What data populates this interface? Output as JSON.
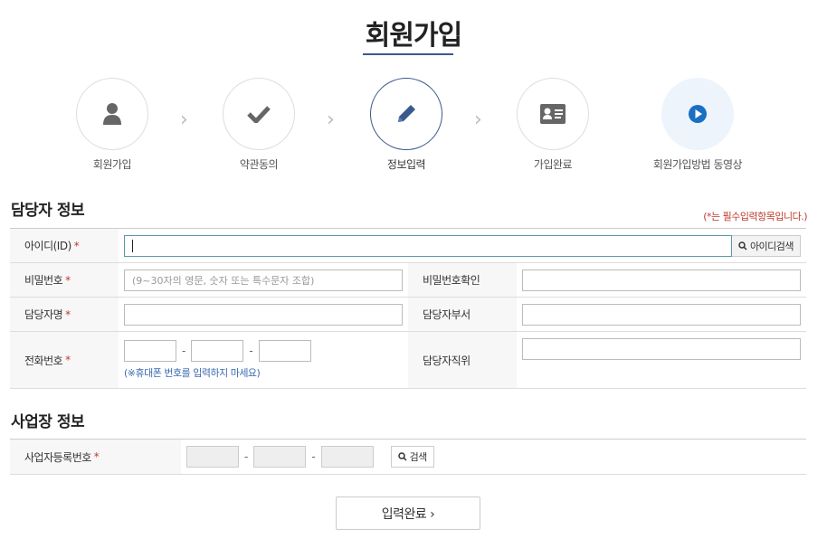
{
  "header": {
    "title": "회원가입"
  },
  "steps": [
    {
      "label": "회원가입",
      "icon": "user-icon"
    },
    {
      "label": "약관동의",
      "icon": "check-icon"
    },
    {
      "label": "정보입력",
      "icon": "pencil-icon"
    },
    {
      "label": "가입완료",
      "icon": "id-card-icon"
    },
    {
      "label": "회원가입방법 동영상",
      "icon": "play-icon"
    }
  ],
  "step_arrow": "›",
  "manager_section": {
    "title": "담당자 정보",
    "required_note": "(*는 필수입력항목입니다.)",
    "required_mark": "*",
    "id_label": "아이디(ID)",
    "id_search_button": "아이디검색",
    "password_label": "비밀번호",
    "password_placeholder": "(9~30자의 영문, 숫자 또는 특수문자 조합)",
    "password_confirm_label": "비밀번호확인",
    "name_label": "담당자명",
    "department_label": "담당자부서",
    "phone_label": "전화번호",
    "phone_separator": "-",
    "phone_hint": "(※휴대폰 번호를 입력하지 마세요)",
    "position_label": "담당자직위"
  },
  "business_section": {
    "title": "사업장 정보",
    "registration_label": "사업자등록번호",
    "separator": "-",
    "search_button": "검색"
  },
  "submit": {
    "label": "입력완료 ›"
  },
  "colors": {
    "accent": "#3a5a8c",
    "required": "#c0392b",
    "hint": "#3a6ab0",
    "play": "#1a6fc4"
  }
}
